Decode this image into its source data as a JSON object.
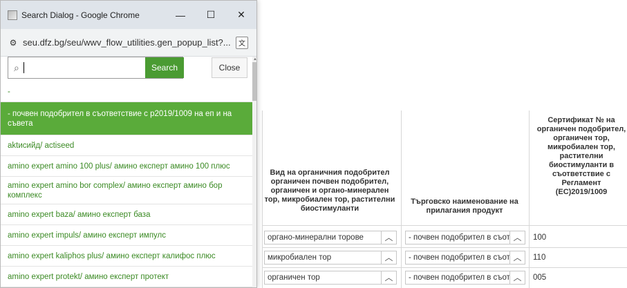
{
  "window": {
    "title": "Search Dialog - Google Chrome",
    "url": "seu.dfz.bg/seu/wwv_flow_utilities.gen_popup_list?...",
    "minimize_glyph": "—",
    "maximize_glyph": "☐",
    "close_glyph": "✕"
  },
  "search": {
    "value": "",
    "search_label": "Search",
    "close_label": "Close"
  },
  "results": [
    "-",
    "- почвен подобрител в съответствие с р2019/1009 на еп и на съвета",
    "aktисийд/ actiseed",
    "amino expert amino 100 plus/ амино експерт амино 100 плюс",
    "amino expert amino bor complex/ амино експерт амино бор комплекс",
    "amino expert baza/ амино експерт база",
    "amino expert impuls/ амино експерт импулс",
    "amino expert kaliphos plus/ амино експерт калифос плюс",
    "amino expert protekt/ амино експерт протект"
  ],
  "background_table": {
    "headers": [
      "Вид на органичния подобрител органичен почвен подобрител, органичен и органо-минерален тор, микробиален тор, растителни биостимуланти",
      "Търговско наименование на прилагания продукт",
      "Сертификат № на органичен подобрител, органичен тор, микробиален тор, растителни биостимуланти в съответствие с Регламент (ЕС)2019/1009"
    ],
    "rows": [
      {
        "type": "органо-минерални торове",
        "trade_name": "- почвен подобрител в съотве",
        "cert": "100"
      },
      {
        "type": "микробиален тор",
        "trade_name": "- почвен подобрител в съотве",
        "cert": "110"
      },
      {
        "type": "органичен тор",
        "trade_name": "- почвен подобрител в съотве",
        "cert": "005"
      }
    ]
  },
  "colors": {
    "accent_green": "#4a9b32",
    "active_row": "#5aab3a",
    "link_green": "#3b8a24"
  }
}
